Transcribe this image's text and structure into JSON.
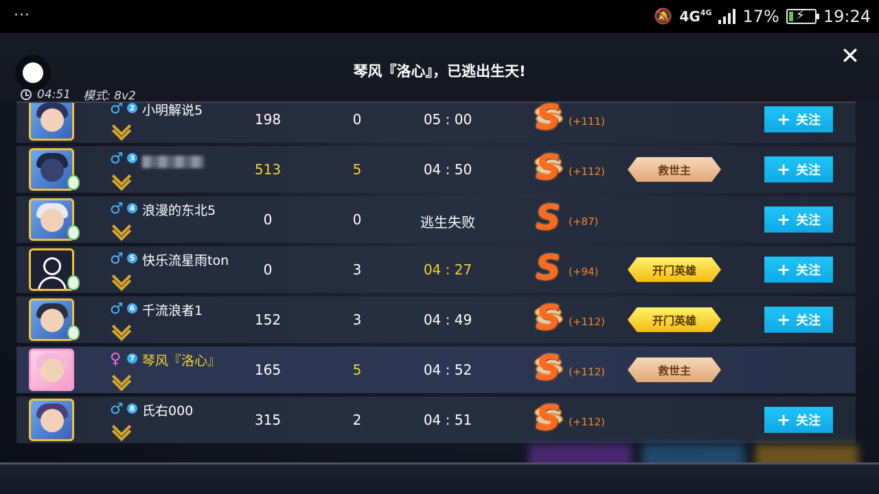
{
  "status_bar": {
    "dots": "···",
    "network": "4G",
    "network_small": "4G",
    "battery": "17%",
    "battery_level": 0.17,
    "time": "19:24"
  },
  "header": {
    "banner": "琴风『洛心』，已逃出生天!",
    "duration": "04:51",
    "mode": "模式: 8v2",
    "close_glyph": "✕"
  },
  "follow": {
    "plus": "+",
    "label": "关注"
  },
  "players": [
    {
      "gender_glyph": "♂",
      "seat": "2",
      "name": "小明解说5",
      "score": "198",
      "rescues": "0",
      "time": "05 : 00",
      "grade": "S",
      "reward": "(+111)",
      "title": ""
    },
    {
      "gender_glyph": "♂",
      "seat": "3",
      "name": "",
      "score": "513",
      "rescues": "5",
      "time": "04 : 50",
      "grade": "S",
      "reward": "(+112)",
      "title": "救世主"
    },
    {
      "gender_glyph": "♂",
      "seat": "4",
      "name": "浪漫的东北5",
      "score": "0",
      "rescues": "0",
      "time": "逃生失败",
      "grade": "S",
      "reward": "(+87)",
      "title": ""
    },
    {
      "gender_glyph": "♂",
      "seat": "5",
      "name": "快乐流星雨ton",
      "score": "0",
      "rescues": "3",
      "time": "04 : 27",
      "grade": "S",
      "reward": "(+94)",
      "title": "开门英雄"
    },
    {
      "gender_glyph": "♂",
      "seat": "6",
      "name": "千流浪者1",
      "score": "152",
      "rescues": "3",
      "time": "04 : 49",
      "grade": "S",
      "reward": "(+112)",
      "title": "开门英雄"
    },
    {
      "gender_glyph": "♀",
      "seat": "7",
      "name": "琴风『洛心』",
      "score": "165",
      "rescues": "5",
      "time": "04 : 52",
      "grade": "S",
      "reward": "(+112)",
      "title": "救世主"
    },
    {
      "gender_glyph": "♂",
      "seat": "8",
      "name": "氏右000",
      "score": "315",
      "rescues": "2",
      "time": "04 : 51",
      "grade": "S",
      "reward": "(+112)",
      "title": ""
    }
  ],
  "colors": {
    "accent_follow": "#10a9e6",
    "highlight_gold": "#f2d233",
    "reward_orange": "#f08a2a",
    "male_blue": "#46b6ff",
    "female_pink": "#f56ce0"
  }
}
